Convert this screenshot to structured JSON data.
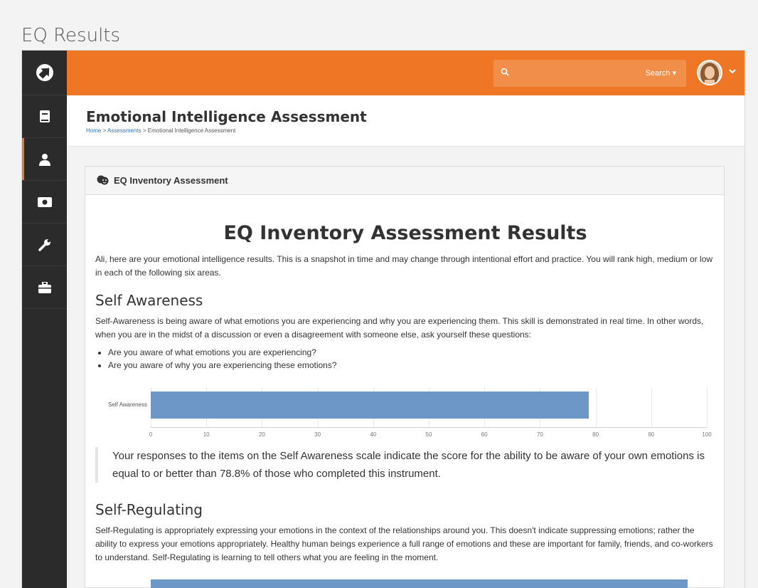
{
  "outer_title": "EQ Results",
  "topbar": {
    "search_label": "Search ▾",
    "search_placeholder": ""
  },
  "page": {
    "title": "Emotional Intelligence Assessment",
    "breadcrumb": [
      {
        "label": "Home",
        "link": true
      },
      {
        "label": "Assessments",
        "link": true
      },
      {
        "label": "Emotional Intelligence Assessment",
        "link": false
      }
    ],
    "breadcrumb_sep": ">"
  },
  "panel": {
    "title": "EQ Inventory Assessment"
  },
  "results": {
    "title": "EQ Inventory Assessment Results",
    "intro": "Ali, here are your emotional intelligence results. This is a snapshot in time and may change through intentional effort and practice. You will rank high, medium or low in each of the following six areas.",
    "self_awareness": {
      "heading": "Self Awareness",
      "description": "Self-Awareness is being aware of what emotions you are experiencing and why you are experiencing them. This skill is demonstrated in real time. In other words, when you are in the midst of a discussion or even a disagreement with someone else, ask yourself these questions:",
      "bullets": [
        "Are you aware of what emotions you are experiencing?",
        "Are you aware of why you are experiencing these emotions?"
      ],
      "summary": "Your responses to the items on the Self Awareness scale indicate the score for the ability to be aware of your own emotions is equal to or better than 78.8% of those who completed this instrument."
    },
    "self_regulating": {
      "heading": "Self-Regulating",
      "description": "Self-Regulating is appropriately expressing your emotions in the context of the relationships around you. This doesn't indicate suppressing emotions; rather the ability to express your emotions appropriately. Healthy human beings experience a full range of emotions and these are important for family, friends, and co-workers to understand. Self-Regulating is learning to tell others what you are feeling in the moment."
    }
  },
  "chart_data": {
    "type": "bar",
    "orientation": "horizontal",
    "categories": [
      "Self Awareness"
    ],
    "values": [
      78.8
    ],
    "xlim": [
      0,
      100
    ],
    "ticks": [
      0,
      10,
      20,
      30,
      40,
      50,
      60,
      70,
      80,
      90,
      100
    ],
    "bar_color": "#6c97c6"
  },
  "colors": {
    "brand": "#ee7625",
    "sidebar": "#2b2b2b",
    "bar": "#6c97c6",
    "link": "#2a73b8"
  },
  "icons": {
    "logo": "rock-logo-icon",
    "sidebar": [
      "book-icon",
      "user-icon",
      "money-icon",
      "wrench-icon",
      "briefcase-icon"
    ],
    "search": "search-icon",
    "panel": "theater-masks-icon"
  }
}
